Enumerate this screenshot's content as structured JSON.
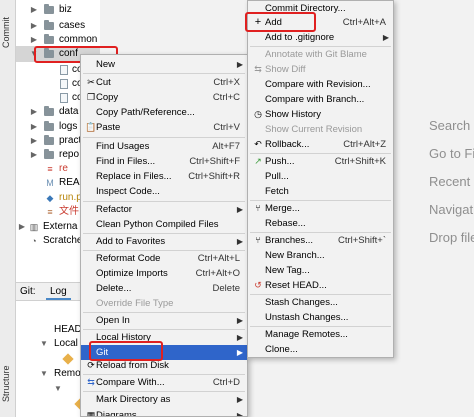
{
  "sidebar": {
    "commit_label": "Commit",
    "structure_label": "Structure"
  },
  "tree": {
    "items": [
      {
        "label": "biz"
      },
      {
        "label": "cases"
      },
      {
        "label": "common"
      },
      {
        "label": "conf"
      },
      {
        "label": "co"
      },
      {
        "label": "co"
      },
      {
        "label": "co"
      },
      {
        "label": "data"
      },
      {
        "label": "logs"
      },
      {
        "label": "pract"
      },
      {
        "label": "repo"
      },
      {
        "label": "re"
      },
      {
        "label": "READ"
      },
      {
        "label": "run.p"
      },
      {
        "label": "文件"
      },
      {
        "label": "Externa"
      },
      {
        "label": "Scratche"
      }
    ]
  },
  "git_panel": {
    "tab_git": "Git:",
    "tab_log": "Log",
    "head": "HEAD",
    "local": "Local",
    "remote": "Remo"
  },
  "context_menu": {
    "items": [
      {
        "label": "New",
        "shortcut": ""
      },
      {
        "label": "Cut",
        "shortcut": "Ctrl+X"
      },
      {
        "label": "Copy",
        "shortcut": "Ctrl+C"
      },
      {
        "label": "Copy Path/Reference...",
        "shortcut": ""
      },
      {
        "label": "Paste",
        "shortcut": "Ctrl+V"
      },
      {
        "label": "Find Usages",
        "shortcut": "Alt+F7"
      },
      {
        "label": "Find in Files...",
        "shortcut": "Ctrl+Shift+F"
      },
      {
        "label": "Replace in Files...",
        "shortcut": "Ctrl+Shift+R"
      },
      {
        "label": "Inspect Code...",
        "shortcut": ""
      },
      {
        "label": "Refactor",
        "shortcut": ""
      },
      {
        "label": "Clean Python Compiled Files",
        "shortcut": ""
      },
      {
        "label": "Add to Favorites",
        "shortcut": ""
      },
      {
        "label": "Reformat Code",
        "shortcut": "Ctrl+Alt+L"
      },
      {
        "label": "Optimize Imports",
        "shortcut": "Ctrl+Alt+O"
      },
      {
        "label": "Delete...",
        "shortcut": "Delete"
      },
      {
        "label": "Override File Type",
        "shortcut": ""
      },
      {
        "label": "Open In",
        "shortcut": ""
      },
      {
        "label": "Local History",
        "shortcut": ""
      },
      {
        "label": "Git",
        "shortcut": ""
      },
      {
        "label": "Reload from Disk",
        "shortcut": ""
      },
      {
        "label": "Compare With...",
        "shortcut": "Ctrl+D"
      },
      {
        "label": "Mark Directory as",
        "shortcut": ""
      },
      {
        "label": "Diagrams",
        "shortcut": ""
      }
    ]
  },
  "git_submenu": {
    "items": [
      {
        "label": "Commit Directory...",
        "shortcut": ""
      },
      {
        "label": "Add",
        "shortcut": "Ctrl+Alt+A"
      },
      {
        "label": "Add to .gitignore",
        "shortcut": ""
      },
      {
        "label": "Annotate with Git Blame",
        "shortcut": ""
      },
      {
        "label": "Show Diff",
        "shortcut": ""
      },
      {
        "label": "Compare with Revision...",
        "shortcut": ""
      },
      {
        "label": "Compare with Branch...",
        "shortcut": ""
      },
      {
        "label": "Show History",
        "shortcut": ""
      },
      {
        "label": "Show Current Revision",
        "shortcut": ""
      },
      {
        "label": "Rollback...",
        "shortcut": "Ctrl+Alt+Z"
      },
      {
        "label": "Push...",
        "shortcut": "Ctrl+Shift+K"
      },
      {
        "label": "Pull...",
        "shortcut": ""
      },
      {
        "label": "Fetch",
        "shortcut": ""
      },
      {
        "label": "Merge...",
        "shortcut": ""
      },
      {
        "label": "Rebase...",
        "shortcut": ""
      },
      {
        "label": "Branches...",
        "shortcut": "Ctrl+Shift+`"
      },
      {
        "label": "New Branch...",
        "shortcut": ""
      },
      {
        "label": "New Tag...",
        "shortcut": ""
      },
      {
        "label": "Reset HEAD...",
        "shortcut": ""
      },
      {
        "label": "Stash Changes...",
        "shortcut": ""
      },
      {
        "label": "Unstash Changes...",
        "shortcut": ""
      },
      {
        "label": "Manage Remotes...",
        "shortcut": ""
      },
      {
        "label": "Clone...",
        "shortcut": ""
      }
    ]
  },
  "editor_hints": [
    "Search E",
    "Go to Fi",
    "Recent F",
    "Navigat",
    "Drop file"
  ],
  "colors": {
    "highlight": "#2f65ca",
    "annotation_outline": "#e02020",
    "disabled_text": "#9a9a9a"
  }
}
